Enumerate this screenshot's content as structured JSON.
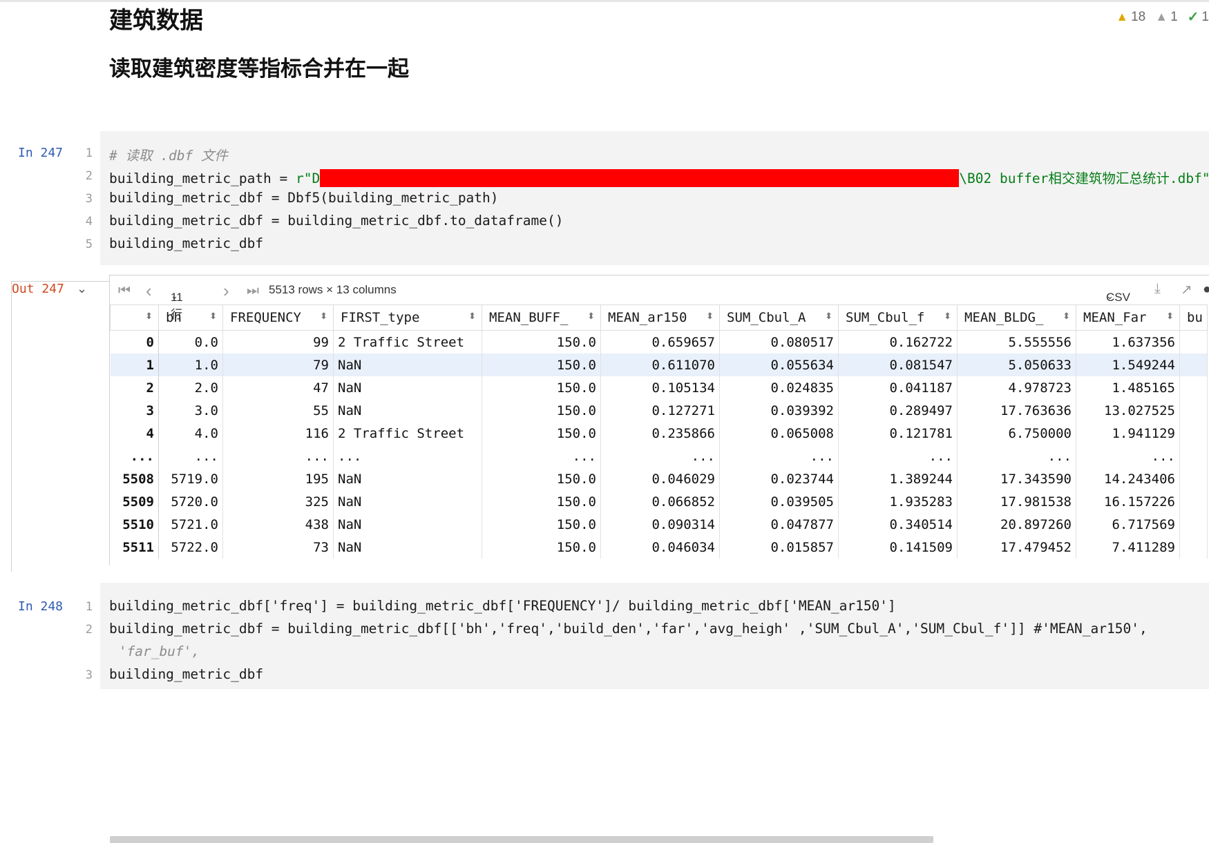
{
  "markdown": {
    "heading1": "建筑数据",
    "heading2": "读取建筑密度等指标合并在一起"
  },
  "inspections": {
    "warnings": "18",
    "weak_warnings": "1",
    "ok": "1"
  },
  "cell1": {
    "prompt": "In 247",
    "line_numbers": [
      "1",
      "2",
      "3",
      "4",
      "5"
    ],
    "comment": "# 读取 .dbf 文件",
    "line2_prefix": "building_metric_path = ",
    "line2_str_start": "r\"D",
    "line2_str_end": "\\B02 buffer相交建筑物汇总统计.dbf\"",
    "line3": "building_metric_dbf = Dbf5(building_metric_path)",
    "line4": "building_metric_dbf = building_metric_dbf.to_dataframe()",
    "line5": "building_metric_dbf"
  },
  "output1": {
    "prompt": "Out 247",
    "toolbar": {
      "first_icon": "⏮",
      "prev_icon": "‹",
      "page_size": "11 行",
      "next_icon": "›",
      "last_icon": "⏭",
      "shape": "5513 rows × 13 columns",
      "export": "CSV"
    },
    "columns": [
      "",
      "bh",
      "FREQUENCY",
      "FIRST_type",
      "MEAN_BUFF_",
      "MEAN_ar150",
      "SUM_Cbul_A",
      "SUM_Cbul_f",
      "MEAN_BLDG_",
      "MEAN_Far",
      "bu"
    ],
    "rows": [
      [
        "0",
        "0.0",
        "99",
        "2 Traffic Street",
        "150.0",
        "0.659657",
        "0.080517",
        "0.162722",
        "5.555556",
        "1.637356",
        ""
      ],
      [
        "1",
        "1.0",
        "79",
        "NaN",
        "150.0",
        "0.611070",
        "0.055634",
        "0.081547",
        "5.050633",
        "1.549244",
        ""
      ],
      [
        "2",
        "2.0",
        "47",
        "NaN",
        "150.0",
        "0.105134",
        "0.024835",
        "0.041187",
        "4.978723",
        "1.485165",
        ""
      ],
      [
        "3",
        "3.0",
        "55",
        "NaN",
        "150.0",
        "0.127271",
        "0.039392",
        "0.289497",
        "17.763636",
        "13.027525",
        ""
      ],
      [
        "4",
        "4.0",
        "116",
        "2 Traffic Street",
        "150.0",
        "0.235866",
        "0.065008",
        "0.121781",
        "6.750000",
        "1.941129",
        ""
      ],
      [
        "...",
        "...",
        "...",
        "...",
        "...",
        "...",
        "...",
        "...",
        "...",
        "...",
        ""
      ],
      [
        "5508",
        "5719.0",
        "195",
        "NaN",
        "150.0",
        "0.046029",
        "0.023744",
        "1.389244",
        "17.343590",
        "14.243406",
        ""
      ],
      [
        "5509",
        "5720.0",
        "325",
        "NaN",
        "150.0",
        "0.066852",
        "0.039505",
        "1.935283",
        "17.981538",
        "16.157226",
        ""
      ],
      [
        "5510",
        "5721.0",
        "438",
        "NaN",
        "150.0",
        "0.090314",
        "0.047877",
        "0.340514",
        "20.897260",
        "6.717569",
        ""
      ],
      [
        "5511",
        "5722.0",
        "73",
        "NaN",
        "150.0",
        "0.046034",
        "0.015857",
        "0.141509",
        "17.479452",
        "7.411289",
        ""
      ]
    ]
  },
  "cell2": {
    "prompt": "In 248",
    "line_numbers": [
      "1",
      "2",
      "3"
    ],
    "line1": "building_metric_dbf['freq'] = building_metric_dbf['FREQUENCY']/ building_metric_dbf['MEAN_ar150']",
    "line2": "building_metric_dbf = building_metric_dbf[['bh','freq','build_den','far','avg_heigh' ,'SUM_Cbul_A','SUM_Cbul_f']] #'MEAN_ar150',",
    "line2_cont": " 'far_buf',",
    "line3": "building_metric_dbf"
  }
}
